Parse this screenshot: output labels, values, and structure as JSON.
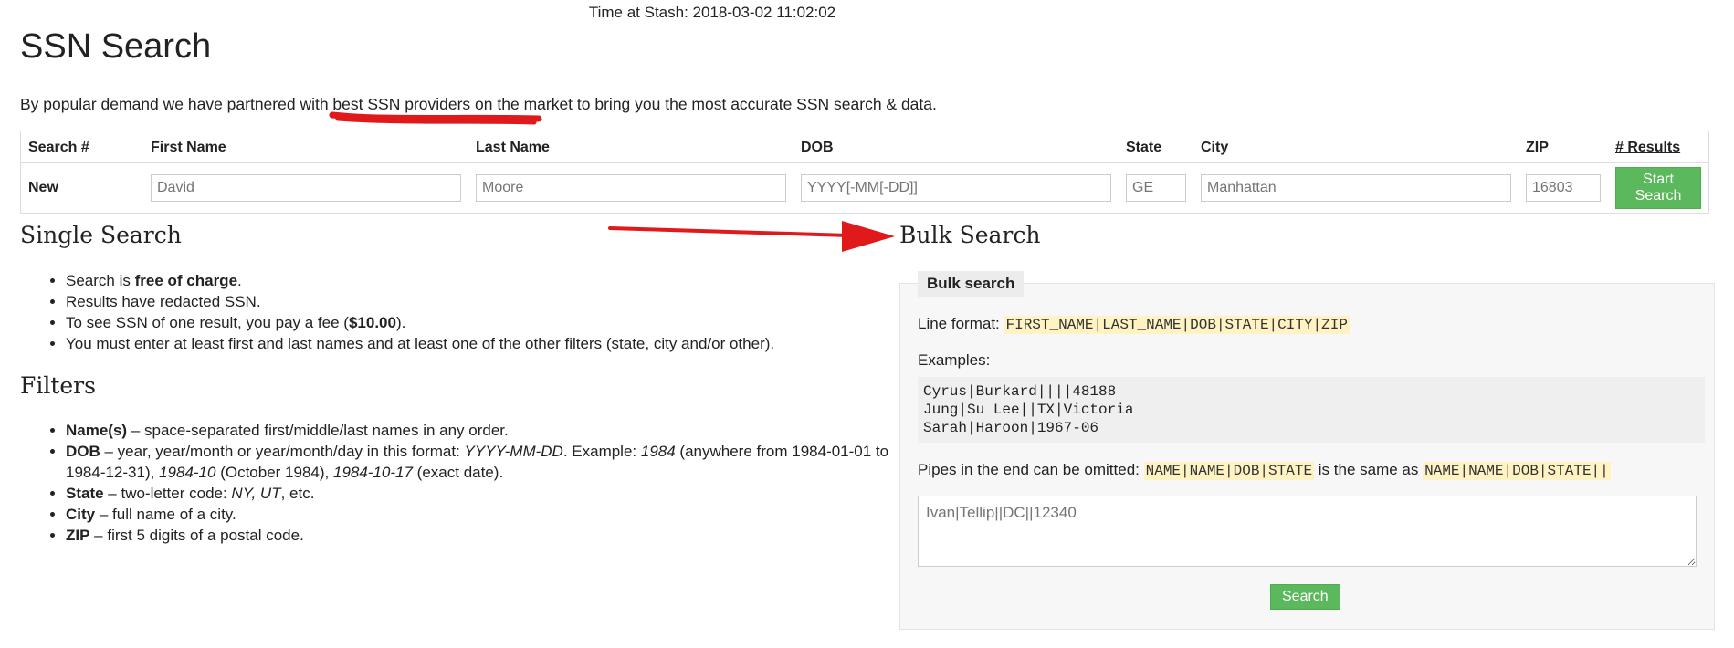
{
  "header": {
    "time_label": "Time at Stash: 2018-03-02 11:02:02",
    "title": "SSN Search",
    "intro": "By popular demand we have partnered with best SSN providers on the market to bring you the most accurate SSN search & data."
  },
  "search_table": {
    "headers": [
      "Search #",
      "First Name",
      "Last Name",
      "DOB",
      "State",
      "City",
      "ZIP",
      "# Results"
    ],
    "row_label": "New",
    "first_name_placeholder": "David",
    "last_name_placeholder": "Moore",
    "dob_placeholder": "YYYY[-MM[-DD]]",
    "state_placeholder": "GE",
    "city_placeholder": "Manhattan",
    "zip_placeholder": "16803",
    "start_button": "Start Search"
  },
  "single_search": {
    "title": "Single Search",
    "items": [
      {
        "pre": "Search is ",
        "bold": "free of charge",
        "post": "."
      },
      {
        "pre": "Results have redacted SSN.",
        "bold": "",
        "post": ""
      },
      {
        "pre": "To see SSN of one result, you pay a fee (",
        "bold": "$10.00",
        "post": ")."
      },
      {
        "pre": "You must enter at least first and last names and at least one of the other filters (state, city and/or other).",
        "bold": "",
        "post": ""
      }
    ]
  },
  "filters": {
    "title": "Filters",
    "name_term": "Name(s)",
    "name_desc": " – space-separated first/middle/last names in any order.",
    "dob_term": "DOB",
    "dob_desc_1": " – year, year/month or year/month/day in this format: ",
    "dob_format": "YYYY-MM-DD",
    "dob_desc_2": ". Example: ",
    "dob_ex1": "1984",
    "dob_desc_3": " (anywhere from 1984-01-01 to 1984-12-31), ",
    "dob_ex2": "1984-10",
    "dob_desc_4": " (October 1984), ",
    "dob_ex3": "1984-10-17",
    "dob_desc_5": " (exact date).",
    "state_term": "State",
    "state_desc": " – two-letter code: ",
    "state_ex": "NY, UT",
    "state_desc_2": ", etc.",
    "city_term": "City",
    "city_desc": " – full name of a city.",
    "zip_term": "ZIP",
    "zip_desc": " – first 5 digits of a postal code."
  },
  "bulk": {
    "title": "Bulk Search",
    "legend": "Bulk search",
    "line_format_label": "Line format: ",
    "line_format": "FIRST_NAME|LAST_NAME|DOB|STATE|CITY|ZIP",
    "examples_label": "Examples:",
    "examples": "Cyrus|Burkard||||48188\nJung|Su Lee||TX|Victoria\nSarah|Haroon|1967-06",
    "pipes_text_1": "Pipes in the end can be omitted: ",
    "pipes_code_1": "NAME|NAME|DOB|STATE",
    "pipes_text_2": " is the same as ",
    "pipes_code_2": "NAME|NAME|DOB|STATE||",
    "textarea_placeholder": "Ivan|Tellip||DC||12340",
    "search_button": "Search"
  },
  "colors": {
    "accent_green": "#5cb85c",
    "annotation_red": "#e0191b",
    "code_highlight": "#fff3c4"
  }
}
